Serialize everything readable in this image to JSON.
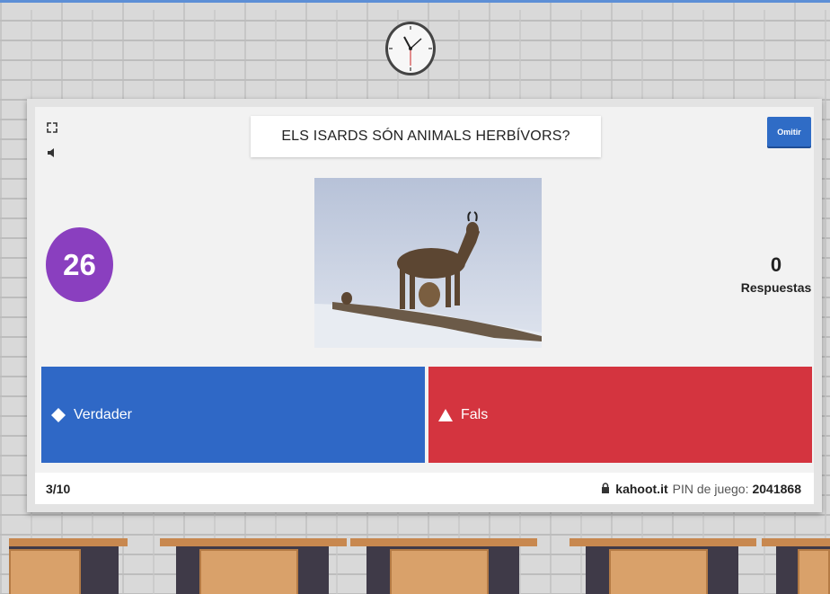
{
  "question": "ELS ISARDS SÓN ANIMALS HERBÍVORS?",
  "skip_label": "Omitir",
  "timer": "26",
  "answers_count": {
    "value": "0",
    "label": "Respuestas"
  },
  "answers": [
    {
      "label": "Verdader",
      "color": "#2f68c6",
      "shape": "diamond"
    },
    {
      "label": "Fals",
      "color": "#d4343f",
      "shape": "triangle"
    }
  ],
  "footer": {
    "progress": "3/10",
    "site": "kahoot.it",
    "pin_label": "PIN de juego:",
    "pin": "2041868"
  },
  "icons": [
    "fullscreen-icon",
    "volume-icon",
    "lock-icon",
    "clock-icon",
    "diamond-icon",
    "triangle-icon"
  ],
  "colors": {
    "timer": "#8a3fbf",
    "skip": "#2f6cc6"
  }
}
